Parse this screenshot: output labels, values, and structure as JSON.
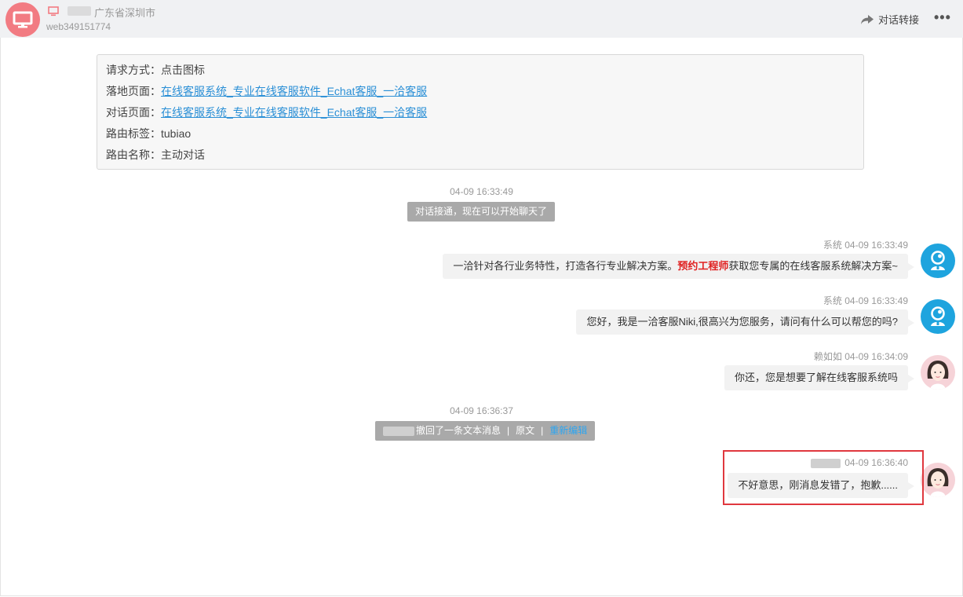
{
  "header": {
    "location": "广东省深圳市",
    "visitor_id": "web349151774",
    "transfer_label": "对话转接",
    "more_label": "•••"
  },
  "info": {
    "rows": [
      {
        "label": "请求方式：",
        "value": "点击图标",
        "is_link": false
      },
      {
        "label": "落地页面：",
        "value": "在线客服系统_专业在线客服软件_Echat客服_一洽客服",
        "is_link": true
      },
      {
        "label": "对话页面：",
        "value": "在线客服系统_专业在线客服软件_Echat客服_一洽客服",
        "is_link": true
      },
      {
        "label": "路由标签：",
        "value": "tubiao",
        "is_link": false
      },
      {
        "label": "路由名称：",
        "value": "主动对话",
        "is_link": false
      }
    ]
  },
  "notices": {
    "connected": {
      "time": "04-09 16:33:49",
      "text": "对话接通，现在可以开始聊天了"
    },
    "recalled": {
      "time": "04-09 16:36:37",
      "text": "撤回了一条文本消息",
      "sep": "|",
      "original": "原文",
      "re_edit": "重新编辑"
    }
  },
  "messages": [
    {
      "sender": "系统",
      "time": "04-09 16:33:49",
      "text_before": "一洽针对各行业务特性，打造各行专业解决方案。",
      "highlight": "预约工程师",
      "text_after": "获取您专属的在线客服系统解决方案~"
    },
    {
      "sender": "系统",
      "time": "04-09 16:33:49",
      "text": "您好，我是一洽客服Niki,很高兴为您服务，请问有什么可以帮您的吗?"
    },
    {
      "sender": "赖如如",
      "time": "04-09 16:34:09",
      "text": "你还，您是想要了解在线客服系统吗"
    },
    {
      "sender": "",
      "time": "04-09 16:36:40",
      "text": "不好意思，刚消息发错了，抱歉......"
    }
  ],
  "colors": {
    "accent": "#f27b82",
    "system_avatar": "#1ea4de",
    "link": "#2a8fd6",
    "highlight_box": "#e0383e"
  }
}
